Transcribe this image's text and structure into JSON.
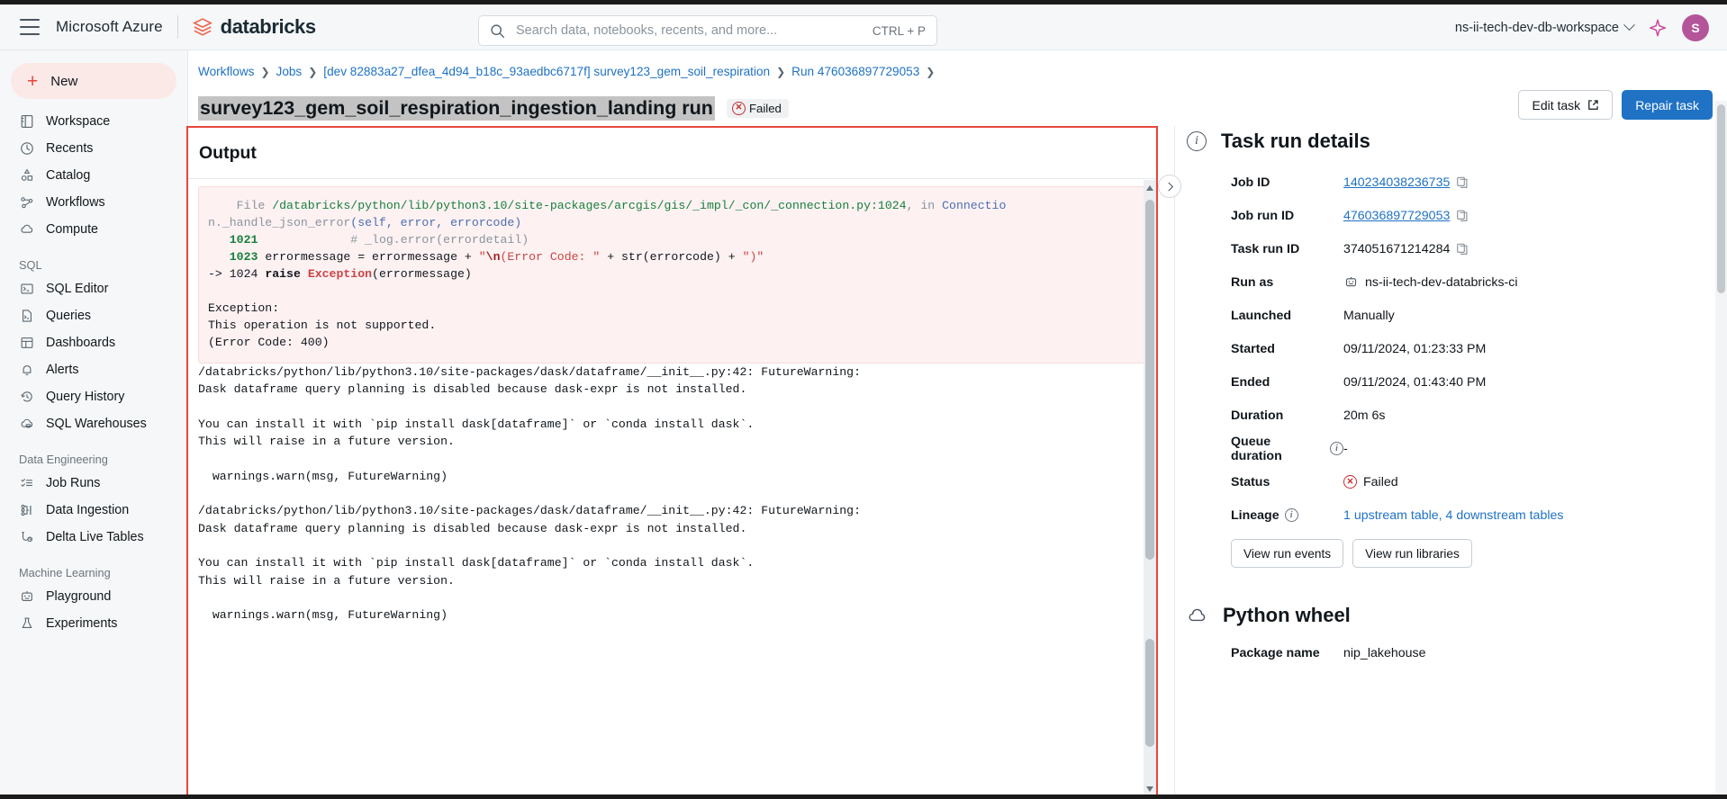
{
  "header": {
    "menu_icon": "hamburger-icon",
    "azure_label": "Microsoft Azure",
    "brand": "databricks",
    "search": {
      "placeholder": "Search data, notebooks, recents, and more...",
      "value": "",
      "shortcut": "CTRL + P",
      "icon": "search-icon"
    },
    "workspace": "ns-ii-tech-dev-db-workspace",
    "assistant_icon": "sparkle-icon",
    "avatar_initial": "S",
    "avatar_color": "#b4559a"
  },
  "sidebar": {
    "new_label": "New",
    "items": [
      {
        "label": "Workspace",
        "icon": "workspace-icon"
      },
      {
        "label": "Recents",
        "icon": "clock-icon"
      },
      {
        "label": "Catalog",
        "icon": "catalog-icon"
      },
      {
        "label": "Workflows",
        "icon": "workflows-icon"
      },
      {
        "label": "Compute",
        "icon": "cloud-icon"
      }
    ],
    "sections": [
      {
        "title": "SQL",
        "items": [
          {
            "label": "SQL Editor",
            "icon": "terminal-icon"
          },
          {
            "label": "Queries",
            "icon": "query-file-icon"
          },
          {
            "label": "Dashboards",
            "icon": "dashboard-grid-icon"
          },
          {
            "label": "Alerts",
            "icon": "bell-icon"
          },
          {
            "label": "Query History",
            "icon": "history-icon"
          },
          {
            "label": "SQL Warehouses",
            "icon": "warehouse-icon"
          }
        ]
      },
      {
        "title": "Data Engineering",
        "items": [
          {
            "label": "Job Runs",
            "icon": "checklist-icon"
          },
          {
            "label": "Data Ingestion",
            "icon": "ingestion-icon"
          },
          {
            "label": "Delta Live Tables",
            "icon": "delta-live-icon"
          }
        ]
      },
      {
        "title": "Machine Learning",
        "items": [
          {
            "label": "Playground",
            "icon": "robot-icon"
          },
          {
            "label": "Experiments",
            "icon": "experiments-icon"
          }
        ]
      }
    ]
  },
  "breadcrumb": [
    "Workflows",
    "Jobs",
    "[dev 82883a27_dfea_4d94_b18c_93aedbc6717f] survey123_gem_soil_respiration",
    "Run 476036897729053"
  ],
  "title": {
    "text": "survey123_gem_soil_respiration_ingestion_landing run",
    "status_badge": "Failed",
    "status_icon": "x-circle-icon"
  },
  "actions": {
    "edit_task": "Edit task",
    "edit_task_icon": "external-link-icon",
    "repair_task": "Repair task"
  },
  "output": {
    "heading": "Output",
    "traceback": {
      "line1_prefix": "File ",
      "line1_path": "/databricks/python/lib/python3.10/site-packages/arcgis/gis/_impl/_con/_connection.py:1024",
      "line1_mid": ", in ",
      "line1_func": "Connectio",
      "line2_a": "n._handle_json_error",
      "line2_b": "(self, error, errorcode)",
      "l1021_num": "1021",
      "l1021_text": "            # _log.error(errordetail)",
      "l1023_num": "1023",
      "l1023_a": " errormessage = errormessage + ",
      "l1023_str_open": "\"",
      "l1023_esc": "\\n",
      "l1023_str_rest": "(Error Code: \"",
      "l1023_tail": " + str(errorcode) + \")\"",
      "arrow_line_prefix": "-> 1024 ",
      "arrow_raise": "raise ",
      "arrow_exc": "Exception",
      "arrow_arg": "(errormessage)",
      "exception_label": "Exception:",
      "exception_msg": "This operation is not supported.",
      "exception_code": "(Error Code: 400)"
    },
    "log_text": "/databricks/python/lib/python3.10/site-packages/dask/dataframe/__init__.py:42: FutureWarning:\nDask dataframe query planning is disabled because dask-expr is not installed.\n\nYou can install it with `pip install dask[dataframe]` or `conda install dask`.\nThis will raise in a future version.\n\n  warnings.warn(msg, FutureWarning)\n\n/databricks/python/lib/python3.10/site-packages/dask/dataframe/__init__.py:42: FutureWarning:\nDask dataframe query planning is disabled because dask-expr is not installed.\n\nYou can install it with `pip install dask[dataframe]` or `conda install dask`.\nThis will raise in a future version.\n\n  warnings.warn(msg, FutureWarning)"
  },
  "details": {
    "heading": "Task run details",
    "heading_icon": "info-icon",
    "rows": [
      {
        "key": "Job ID",
        "value": "140234038236735",
        "link": true,
        "copy": true
      },
      {
        "key": "Job run ID",
        "value": "476036897729053",
        "link": true,
        "copy": true
      },
      {
        "key": "Task run ID",
        "value": "374051671214284",
        "link": false,
        "copy": true
      },
      {
        "key": "Run as",
        "value": "ns-ii-tech-dev-databricks-ci",
        "link": false,
        "copy": false,
        "icon": "robot-icon"
      },
      {
        "key": "Launched",
        "value": "Manually",
        "link": false,
        "copy": false
      },
      {
        "key": "Started",
        "value": "09/11/2024, 01:23:33 PM",
        "link": false,
        "copy": false
      },
      {
        "key": "Ended",
        "value": "09/11/2024, 01:43:40 PM",
        "link": false,
        "copy": false
      },
      {
        "key": "Duration",
        "value": "20m 6s",
        "link": false,
        "copy": false
      },
      {
        "key": "Queue duration",
        "value": "-",
        "link": false,
        "copy": false,
        "info": true
      },
      {
        "key": "Status",
        "value": "Failed",
        "link": false,
        "copy": false,
        "status_icon": "x-circle-icon"
      },
      {
        "key": "Lineage",
        "value": "1 upstream table, 4 downstream tables",
        "link": true,
        "copy": false,
        "info": true
      }
    ],
    "buttons": [
      "View run events",
      "View run libraries"
    ],
    "wheel_heading": "Python wheel",
    "wheel_icon": "cloud-icon",
    "package_key": "Package name",
    "package_value": "nip_lakehouse"
  }
}
